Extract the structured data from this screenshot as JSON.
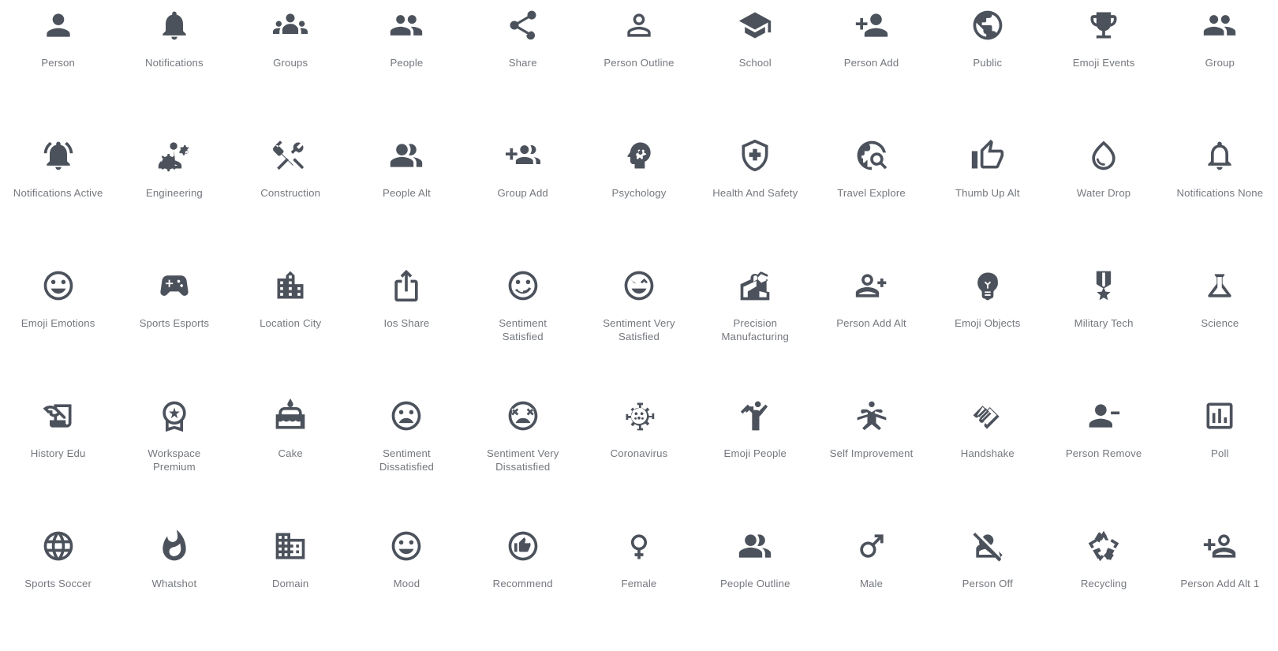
{
  "page": {
    "title": "Material Icons Gallery",
    "background_color": "#ffffff",
    "icon_color": "#4c525c",
    "label_color": "#74787e",
    "columns": 11,
    "rows": 5,
    "total_icons": 55
  },
  "icons": [
    {
      "label": "Person",
      "icon": "person-icon"
    },
    {
      "label": "Notifications",
      "icon": "notifications-icon"
    },
    {
      "label": "Groups",
      "icon": "groups-icon"
    },
    {
      "label": "People",
      "icon": "people-icon"
    },
    {
      "label": "Share",
      "icon": "share-icon"
    },
    {
      "label": "Person Outline",
      "icon": "person-outline-icon"
    },
    {
      "label": "School",
      "icon": "school-icon"
    },
    {
      "label": "Person Add",
      "icon": "person-add-icon"
    },
    {
      "label": "Public",
      "icon": "public-icon"
    },
    {
      "label": "Emoji Events",
      "icon": "emoji-events-icon"
    },
    {
      "label": "Group",
      "icon": "group-icon"
    },
    {
      "label": "Notifications Active",
      "icon": "notifications-active-icon"
    },
    {
      "label": "Engineering",
      "icon": "engineering-icon"
    },
    {
      "label": "Construction",
      "icon": "construction-icon"
    },
    {
      "label": "People Alt",
      "icon": "people-alt-icon"
    },
    {
      "label": "Group Add",
      "icon": "group-add-icon"
    },
    {
      "label": "Psychology",
      "icon": "psychology-icon"
    },
    {
      "label": "Health And Safety",
      "icon": "health-and-safety-icon"
    },
    {
      "label": "Travel Explore",
      "icon": "travel-explore-icon"
    },
    {
      "label": "Thumb Up Alt",
      "icon": "thumb-up-alt-icon"
    },
    {
      "label": "Water Drop",
      "icon": "water-drop-icon"
    },
    {
      "label": "Notifications None",
      "icon": "notifications-none-icon"
    },
    {
      "label": "Emoji Emotions",
      "icon": "emoji-emotions-icon"
    },
    {
      "label": "Sports Esports",
      "icon": "sports-esports-icon"
    },
    {
      "label": "Location City",
      "icon": "location-city-icon"
    },
    {
      "label": "Ios Share",
      "icon": "ios-share-icon"
    },
    {
      "label": "Sentiment Satisfied",
      "icon": "sentiment-satisfied-icon"
    },
    {
      "label": "Sentiment Very Satisfied",
      "icon": "sentiment-very-satisfied-icon"
    },
    {
      "label": "Precision Manufacturing",
      "icon": "precision-manufacturing-icon"
    },
    {
      "label": "Person Add Alt",
      "icon": "person-add-alt-icon"
    },
    {
      "label": "Emoji Objects",
      "icon": "emoji-objects-icon"
    },
    {
      "label": "Military Tech",
      "icon": "military-tech-icon"
    },
    {
      "label": "Science",
      "icon": "science-icon"
    },
    {
      "label": "History Edu",
      "icon": "history-edu-icon"
    },
    {
      "label": "Workspace Premium",
      "icon": "workspace-premium-icon"
    },
    {
      "label": "Cake",
      "icon": "cake-icon"
    },
    {
      "label": "Sentiment Dissatisfied",
      "icon": "sentiment-dissatisfied-icon"
    },
    {
      "label": "Sentiment Very Dissatisfied",
      "icon": "sentiment-very-dissatisfied-icon"
    },
    {
      "label": "Coronavirus",
      "icon": "coronavirus-icon"
    },
    {
      "label": "Emoji People",
      "icon": "emoji-people-icon"
    },
    {
      "label": "Self Improvement",
      "icon": "self-improvement-icon"
    },
    {
      "label": "Handshake",
      "icon": "handshake-icon"
    },
    {
      "label": "Person Remove",
      "icon": "person-remove-icon"
    },
    {
      "label": "Poll",
      "icon": "poll-icon"
    },
    {
      "label": "Sports Soccer",
      "icon": "sports-soccer-icon"
    },
    {
      "label": "Whatshot",
      "icon": "whatshot-icon"
    },
    {
      "label": "Domain",
      "icon": "domain-icon"
    },
    {
      "label": "Mood",
      "icon": "mood-icon"
    },
    {
      "label": "Recommend",
      "icon": "recommend-icon"
    },
    {
      "label": "Female",
      "icon": "female-icon"
    },
    {
      "label": "People Outline",
      "icon": "people-outline-icon"
    },
    {
      "label": "Male",
      "icon": "male-icon"
    },
    {
      "label": "Person Off",
      "icon": "person-off-icon"
    },
    {
      "label": "Recycling",
      "icon": "recycling-icon"
    },
    {
      "label": "Person Add Alt 1",
      "icon": "person-add-alt-1-icon"
    }
  ]
}
